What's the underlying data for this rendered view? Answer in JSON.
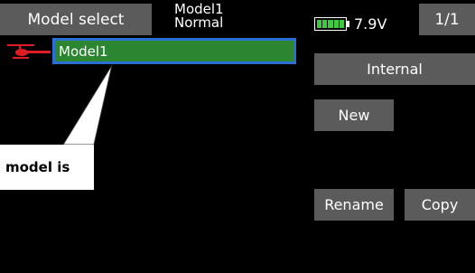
{
  "header": {
    "title": "Model select",
    "model_name": "Model1",
    "condition": "Normal",
    "voltage": "7.9V",
    "page": "1/1"
  },
  "model_list": [
    {
      "name": "Model1",
      "icon": "helicopter-icon",
      "selected": true
    }
  ],
  "buttons": {
    "storage": "Internal",
    "new": "New",
    "rename": "Rename",
    "copy": "Copy"
  },
  "callout": {
    "text": "model is"
  },
  "colors": {
    "selection_fill": "#2c8530",
    "selection_border": "#2a6fd6",
    "button_gray": "#5b5b5b",
    "heli_red": "#e01b24",
    "battery_green": "#3ccb3c"
  }
}
